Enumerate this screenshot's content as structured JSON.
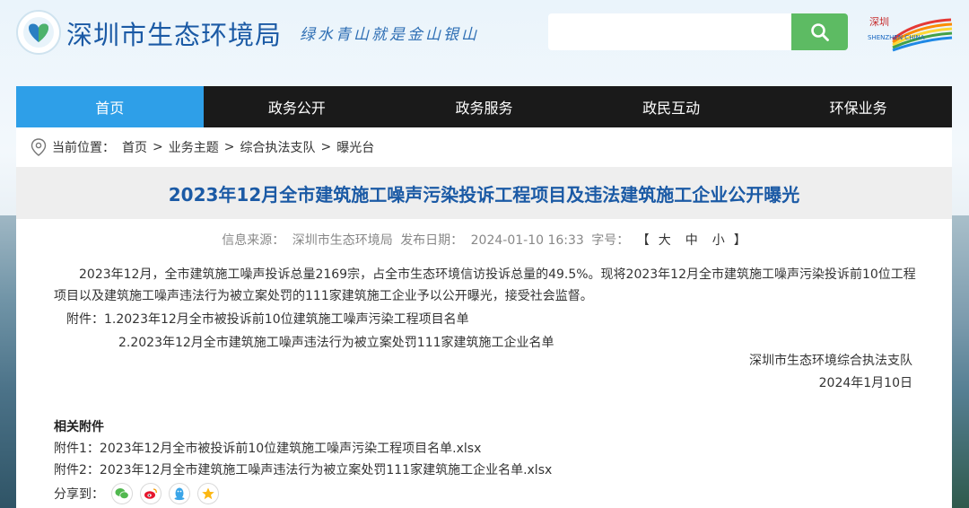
{
  "header": {
    "site_title": "深圳市生态环境局",
    "slogan": "绿水青山就是金山银山",
    "search_placeholder": "",
    "sz_logo_text": "SHENZHEN CHINA"
  },
  "nav": {
    "items": [
      {
        "label": "首页",
        "active": true
      },
      {
        "label": "政务公开",
        "active": false
      },
      {
        "label": "政务服务",
        "active": false
      },
      {
        "label": "政民互动",
        "active": false
      },
      {
        "label": "环保业务",
        "active": false
      }
    ]
  },
  "breadcrumb": {
    "prefix": "当前位置：",
    "items": [
      "首页",
      "业务主题",
      "综合执法支队",
      "曝光台"
    ],
    "separator": ">"
  },
  "article": {
    "title": "2023年12月全市建筑施工噪声污染投诉工程项目及违法建筑施工企业公开曝光",
    "meta": {
      "source_label": "信息来源：",
      "source": "深圳市生态环境局",
      "date_label": "发布日期：",
      "date": "2024-01-10 16:33",
      "fontsize_label": "字号：",
      "bracket_open": "【",
      "bracket_close": "】",
      "sizes": [
        "大",
        "中",
        "小"
      ]
    },
    "paragraph1": "2023年12月，全市建筑施工噪声投诉总量2169宗，占全市生态环境信访投诉总量的49.5%。现将2023年12月全市建筑施工噪声污染投诉前10位工程项目以及建筑施工噪声违法行为被立案处罚的111家建筑施工企业予以公开曝光，接受社会监督。",
    "attachment_line1": "附件：1.2023年12月全市被投诉前10位建筑施工噪声污染工程项目名单",
    "attachment_line2": "2.2023年12月全市建筑施工噪声违法行为被立案处罚111家建筑施工企业名单",
    "signature_org": "深圳市生态环境综合执法支队",
    "signature_date": "2024年1月10日"
  },
  "related": {
    "title": "相关附件",
    "items": [
      "附件1：2023年12月全市被投诉前10位建筑施工噪声污染工程项目名单.xlsx",
      "附件2：2023年12月全市建筑施工噪声违法行为被立案处罚111家建筑施工企业名单.xlsx"
    ]
  },
  "share": {
    "label": "分享到：",
    "icons": [
      "wechat-icon",
      "weibo-icon",
      "qq-icon",
      "qzone-icon"
    ]
  },
  "colors": {
    "nav_bg": "#1a1a1a",
    "nav_active": "#2e9fe8",
    "title_blue": "#1b5aa5",
    "search_green": "#5dbb63"
  }
}
